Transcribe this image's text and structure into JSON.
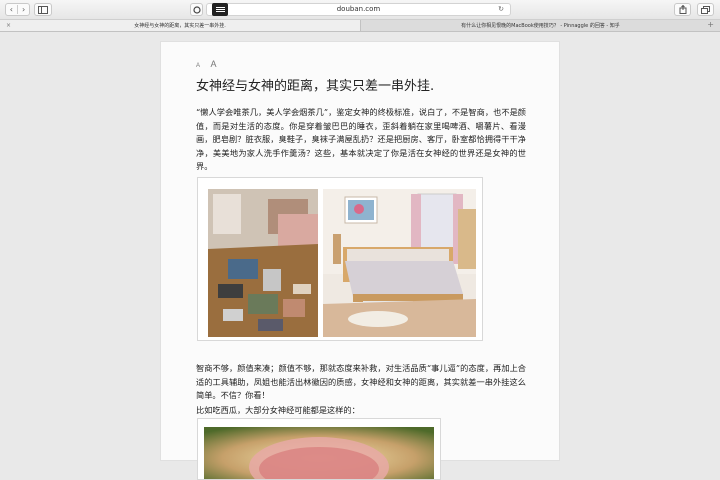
{
  "toolbar": {
    "back_icon": "chevron-left-icon",
    "forward_icon": "chevron-right-icon",
    "sidebar_icon": "sidebar-icon",
    "url": "douban.com",
    "share_icon": "share-icon",
    "tabs_icon": "tabs-icon"
  },
  "tabs": [
    {
      "title": "女神经与女神的距离，其实只差一串外挂.",
      "active": true
    },
    {
      "title": "有什么让你相见恨晚的MacBook使用技巧？ - Pinnaggle 的回答 - 知乎",
      "active": false
    }
  ],
  "reader": {
    "font_small": "A",
    "font_large": "A",
    "title": "女神经与女神的距离，其实只差一串外挂.",
    "paragraph1": "“懒人学会唯茶几，美人学会烟茶几”，鉴定女神的终极标准，说白了，不是智商，也不是颜值，而是对生活的态度。你是穿着皱巴巴的睡衣，歪斜着躺在家里喝啤酒、嚼薯片、看漫画，肥皂剧？脏衣服，臭鞋子，臭袜子满屋乱扔？还是把厨房、客厅，卧室都恰拥得干干净净，美美地为家人洗手作羹汤？这些，基本就决定了你是活在女神经的世界还是女神的世界。",
    "paragraph2": "智商不够，颜值来凑；颜值不够，那就态度来补救，对生活品质“事儿逼”的态度，再加上合适的工具辅助，凤姐也能活出林徽因的质感，女神经和女神的距离，其实就差一串外挂这么简单。不信？你看！",
    "paragraph3": "比如吃西瓜，大部分女神经可能都是这样的："
  }
}
